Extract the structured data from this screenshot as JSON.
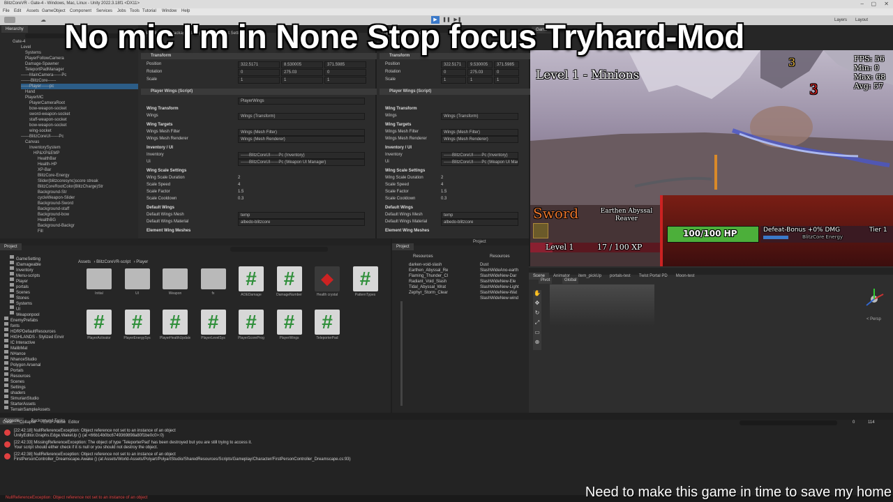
{
  "window": {
    "title": "BlitzCoreVR - Gate-4 - Windows, Mac, Linux - Unity 2022.3.18f1 <DX11>",
    "menu": [
      "File",
      "Edit",
      "Assets",
      "GameObject",
      "Component",
      "Services",
      "Jobs",
      "Tools",
      "Tutorial",
      "Window",
      "Help"
    ],
    "right_tabs": [
      "Layers",
      "Layout"
    ]
  },
  "overlay": {
    "title": "No mic I'm in None Stop focus Tryhard-Mod",
    "caption": "Need to make this game in time to save my home"
  },
  "hierarchy": {
    "tab": "Hierarchy",
    "items": [
      "Gate-4",
      "Level",
      "Systems",
      "PlayerFollowCamera",
      "Damage-Spawner",
      "TeleportPadManager",
      "------MainCamera------Pc",
      "-------BlitzCore------",
      "------Player------pc",
      "Hand",
      "PlayerMC",
      "PlayerCameraRoot",
      "bow-weapon-socket",
      "sword-weapon-socket",
      "staff-weapon-socket",
      "bow-weapon-socket",
      "wing-socket",
      "------BlitzCoreUI------Pc",
      "Canvas",
      "InventorySystem",
      "HP&XP&EMP",
      "HealthBar",
      "Health-HP",
      "XP-Bar",
      "BlitzCore-Energy",
      "Slider(blitzcoresync)score streak",
      "BlitzCoreRootColor(BlitzCharge)Str",
      "Background-Str",
      "cycleWeapon-Slider",
      "Background-Sword",
      "Background-staff",
      "Background-bow",
      "HealthBG",
      "Background-Backgr",
      "Fill"
    ]
  },
  "inspector_left": {
    "tabs": [
      "Inspector",
      "Package Manager",
      "Project Settings"
    ],
    "transform": {
      "title": "Transform",
      "position": [
        "322.5171",
        "8.530005",
        "371.5985"
      ],
      "rotation": [
        "0",
        "275.03",
        "0"
      ],
      "scale": [
        "1",
        "1",
        "1"
      ]
    },
    "component": "Player Wings (Script)",
    "script": "PlayerWings",
    "wing_transform": {
      "header": "Wing Transform",
      "label": "Wings",
      "value": "Wings (Transform)"
    },
    "wing_targets": {
      "header": "Wing Targets",
      "filter_label": "Wings Mesh Filter",
      "filter_value": "Wings (Mesh Filter)",
      "renderer_label": "Wings Mesh Renderer",
      "renderer_value": "Wings (Mesh Renderer)"
    },
    "inventory": {
      "header": "Inventory / UI",
      "inv_label": "Inventory",
      "inv_value": "------BlitzCoreUI------Pc (Inventory)",
      "ui_label": "Ui",
      "ui_value": "------BlitzCoreUI------Pc (Weapon UI Manager)"
    },
    "scale_settings": {
      "header": "Wing Scale Settings",
      "rows": [
        [
          "Wing Scale Duration",
          "2"
        ],
        [
          "Scale Speed",
          "4"
        ],
        [
          "Scale Factor",
          "1.5"
        ],
        [
          "Scale Cooldown",
          "0.3"
        ]
      ]
    },
    "default_wings": {
      "header": "Default Wings",
      "mesh_label": "Default Wings Mesh",
      "mesh_value": "temp",
      "mat_label": "Default Wings Material",
      "mat_value": "albedo-blitzcore"
    },
    "element_wing_meshes": "Element Wing Meshes"
  },
  "inspector_right": {
    "tabs": [
      "Inspector",
      "Project Settings"
    ],
    "transform": {
      "title": "Transform",
      "position": [
        "322.5171",
        "9.530005",
        "371.5985"
      ],
      "rotation": [
        "0",
        "275.03",
        "0"
      ],
      "scale": [
        "1",
        "1",
        "1"
      ]
    },
    "component": "Player Wings (Script)",
    "wing_transform": {
      "header": "Wing Transform",
      "label": "Wings",
      "value": "Wings (Transform)"
    },
    "wing_targets": {
      "header": "Wing Targets",
      "filter_label": "Wings Mesh Filter",
      "filter_value": "Wings (Mesh Filter)",
      "renderer_label": "Wings Mesh Renderer",
      "renderer_value": "Wings (Mesh Renderer)"
    },
    "inventory": {
      "header": "Inventory / UI",
      "inv_label": "Inventory",
      "inv_value": "------BlitzCoreUI------Pc (Inventory)",
      "ui_label": "Ui",
      "ui_value": "------BlitzCoreUI------Pc (Weapon UI Manager)"
    },
    "scale_settings": {
      "header": "Wing Scale Settings",
      "rows": [
        [
          "Wing Scale Duration",
          "2"
        ],
        [
          "Scale Speed",
          "4"
        ],
        [
          "Scale Factor",
          "1.5"
        ],
        [
          "Scale Cooldown",
          "0.3"
        ]
      ]
    },
    "default_wings": {
      "header": "Default Wings",
      "mesh_label": "Default Wings Mesh",
      "mesh_value": "temp",
      "mat_label": "Default Wings Material",
      "mat_value": "albedo-blitzcore"
    },
    "element_wing_meshes": "Element Wing Meshes"
  },
  "project": {
    "tab": "Project",
    "breadcrumb": [
      "Assets",
      "BlitzCoreVR-script",
      "Player"
    ],
    "folders": [
      "GameSetting",
      "IDamageable",
      "Inventory",
      "Menu-scripts",
      "Player",
      "portals",
      "Scenes",
      "Stones",
      "Systems",
      "UI",
      "Weaponpool",
      "EnemyPrefabs",
      "fonts",
      "HDRPDefaultResources",
      "HIGHLANDS - Stylized Envir",
      "IC Interactive",
      "MalibMat",
      "NHance",
      "NhanceStudio",
      "Polygon Arsenal",
      "Portals",
      "Resources",
      "Scenes",
      "Settings",
      "shaders",
      "SimurianStudio",
      "StarterAssets",
      "TerrainSampleAssets"
    ],
    "files_row1": [
      "Initial",
      "UI",
      "Weapon",
      "fx",
      "AOEDamage",
      "DamageNumber",
      "Health crystal",
      "PatternTypes"
    ],
    "files_row2": [
      "PlayerActivator",
      "PlayerEnergySys",
      "PlayerHealthUpdate",
      "PlayerLevelSys",
      "PlayerScoreProg",
      "PlayerWings",
      "TeleporterPad"
    ]
  },
  "project2": {
    "tab": "Project",
    "crumbs": [
      "Assets",
      "Resources"
    ],
    "list_a": [
      "darken-void-slash",
      "Earthen_Abyssal_Re",
      "Flaming_Thunder_Cl",
      "Radiant_Void_Slash",
      "Tidal_Abyssal_Wrat",
      "Zephyr_Storm_Clear"
    ],
    "list_b": [
      "Dust",
      "SlashWideAno-earth",
      "SlashWideNew-Dar",
      "SlashWideNew-Ele",
      "SlashWideNew-Light",
      "SlashWideNew-Wat",
      "SlashWideNew-wind"
    ]
  },
  "game": {
    "tabs": [
      "Game",
      "Scene"
    ],
    "fps": [
      "FPS: 56",
      "Min: 0",
      "Max: 68",
      "Avg: 57"
    ],
    "level_title": "Level 1 - Minions",
    "weapon": "Sword",
    "weapon_sub": "Earthen Abyssal Reaver",
    "hp": "100/100 HP",
    "hp_fraction": 1.0,
    "defeat_bonus": "Defeat-Bonus +0% DMG",
    "tier": "Tier 1",
    "energy": "BlitzCore Energy",
    "level": "Level 1",
    "xp": "17 / 100 XP",
    "xp_fraction": 0.17,
    "float_a": "3",
    "float_b": "3"
  },
  "scene": {
    "tabs": [
      "Scene",
      "Animator",
      "item_pickUp",
      "portals-test",
      "Twist Portal PD",
      "Moon-test"
    ],
    "toolbar_left": "Pivot",
    "toolbar_right": "Global",
    "gizmo_label": "< Persp"
  },
  "console": {
    "tabs": [
      "Console",
      "Background Tasks"
    ],
    "toolbar": [
      "Clear",
      "Collapse",
      "Error Pause",
      "Editor"
    ],
    "logs": [
      "[22:42:18] NullReferenceException: Object reference not set to an instance of an object",
      "UnityEditor.Graphs.Edge.WakeUp () (at <66b14b0bc6749369898a80f1be0c0>:0)",
      "[22:42:33] MissingReferenceException: The object of type 'TeleporterPad' has been destroyed but you are still trying to access it.",
      "Your script should either check if it is null or you should not destroy the object.",
      "[22:42:38] NullReferenceException: Object reference not set to an instance of an object",
      "FirstPersonController_Dreamscape.Awake () (at Assets/World-Assets/Polyart/PolyartStudio/SharedResources/Scripts/Gameplay/Character/FirstPersonController_Dreamscape.cs:93)"
    ],
    "counts": [
      "0",
      "114"
    ],
    "status": "NullReferenceException: Object reference not set to an instance of an object"
  },
  "colors": {
    "accent": "#3b79c9",
    "error": "#e04040",
    "hp": "#4caf3a",
    "weapon": "#e8742a"
  }
}
